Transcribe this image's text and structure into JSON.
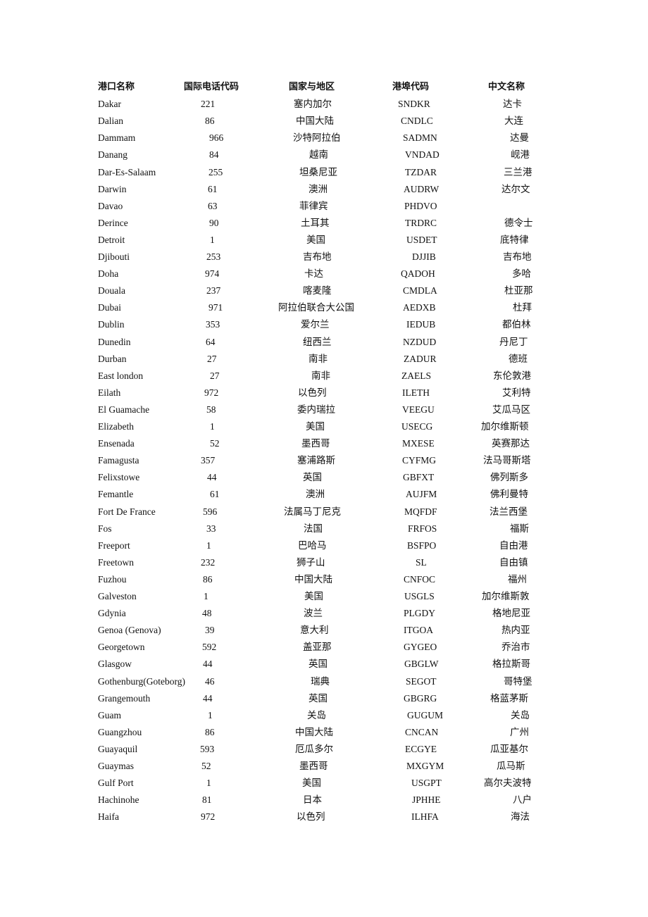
{
  "table": {
    "headers": [
      "港口名称",
      "国际电话代码",
      "国家与地区",
      "港埠代码",
      "中文名称"
    ],
    "rows": [
      [
        "Dakar",
        "221",
        "塞内加尔",
        "SNDKR",
        "达卡"
      ],
      [
        "Dalian",
        "86",
        "中国大陆",
        "CNDLC",
        "大连"
      ],
      [
        "Dammam",
        "966",
        "沙特阿拉伯",
        "SADMN",
        "达曼"
      ],
      [
        "Danang",
        "84",
        "越南",
        "VNDAD",
        "岘港"
      ],
      [
        "Dar-Es-Salaam",
        "255",
        "坦桑尼亚",
        "TZDAR",
        "三兰港"
      ],
      [
        "Darwin",
        "61",
        "澳洲",
        "AUDRW",
        "达尔文"
      ],
      [
        "Davao",
        "63",
        "菲律宾",
        "PHDVO",
        ""
      ],
      [
        "Derince",
        "90",
        "土耳其",
        "TRDRC",
        "德令士"
      ],
      [
        "Detroit",
        "1",
        "美国",
        "USDET",
        "底特律"
      ],
      [
        "Djibouti",
        "253",
        "吉布地",
        "DJJIB",
        "吉布地"
      ],
      [
        "Doha",
        "974",
        "卡达",
        "QADOH",
        "多哈"
      ],
      [
        "Douala",
        "237",
        "喀麦隆",
        "CMDLA",
        "杜亚那"
      ],
      [
        "Dubai",
        "971",
        "阿拉伯联合大公国",
        "AEDXB",
        "杜拜"
      ],
      [
        "Dublin",
        "353",
        "爱尔兰",
        "IEDUB",
        "都伯林"
      ],
      [
        "Dunedin",
        "64",
        "纽西兰",
        "NZDUD",
        "丹尼丁"
      ],
      [
        "Durban",
        "27",
        "南非",
        "ZADUR",
        "德班"
      ],
      [
        "East london",
        "27",
        "南非",
        "ZAELS",
        "东伦敦港"
      ],
      [
        "Eilath",
        "972",
        "以色列",
        "ILETH",
        "艾利特"
      ],
      [
        "El Guamache",
        "58",
        "委内瑞拉",
        "VEEGU",
        "艾瓜马区"
      ],
      [
        "Elizabeth",
        "1",
        "美国",
        "USECG",
        "加尔维斯顿"
      ],
      [
        "Ensenada",
        "52",
        "墨西哥",
        "MXESE",
        "英赛那达"
      ],
      [
        "Famagusta",
        "357",
        "塞浦路斯",
        "CYFMG",
        "法马哥斯塔"
      ],
      [
        "Felixstowe",
        "44",
        "英国",
        "GBFXT",
        "佛列斯多"
      ],
      [
        "Femantle",
        "61",
        "澳洲",
        "AUJFM",
        "佛利曼特"
      ],
      [
        "Fort De France",
        "596",
        "法属马丁尼克",
        "MQFDF",
        "法兰西堡"
      ],
      [
        "Fos",
        "33",
        "法国",
        "FRFOS",
        "福斯"
      ],
      [
        "Freeport",
        "1",
        "巴哈马",
        "BSFPO",
        "自由港"
      ],
      [
        "Freetown",
        "232",
        "狮子山",
        "SL",
        "自由镇"
      ],
      [
        "Fuzhou",
        "86",
        "中国大陆",
        "CNFOC",
        "福州"
      ],
      [
        "Galveston",
        "1",
        "美国",
        "USGLS",
        "加尔维斯敦"
      ],
      [
        "Gdynia",
        "48",
        "波兰",
        "PLGDY",
        "格地尼亚"
      ],
      [
        "Genoa (Genova)",
        "39",
        "意大利",
        "ITGOA",
        "热内亚"
      ],
      [
        "Georgetown",
        "592",
        "盖亚那",
        "GYGEO",
        "乔治市"
      ],
      [
        "Glasgow",
        "44",
        "英国",
        "GBGLW",
        "格拉斯哥"
      ],
      [
        "Gothenburg(Goteborg)",
        "46",
        "瑞典",
        "SEGOT",
        "哥特堡"
      ],
      [
        "Grangemouth",
        "44",
        "英国",
        "GBGRG",
        "格蓝茅斯"
      ],
      [
        "Guam",
        "1",
        "关岛",
        "GUGUM",
        "关岛"
      ],
      [
        "Guangzhou",
        "86",
        "中国大陆",
        "CNCAN",
        "广州"
      ],
      [
        "Guayaquil",
        "593",
        "厄瓜多尔",
        "ECGYE",
        "瓜亚基尔"
      ],
      [
        "Guaymas",
        "52",
        "墨西哥",
        "MXGYM",
        "瓜马斯"
      ],
      [
        "Gulf Port",
        "1",
        "美国",
        "USGPT",
        "高尔夫波特"
      ],
      [
        "Hachinohe",
        "81",
        "日本",
        "JPHHE",
        "八户"
      ],
      [
        "Haifa",
        "972",
        "以色列",
        "ILHFA",
        "海法"
      ]
    ]
  }
}
